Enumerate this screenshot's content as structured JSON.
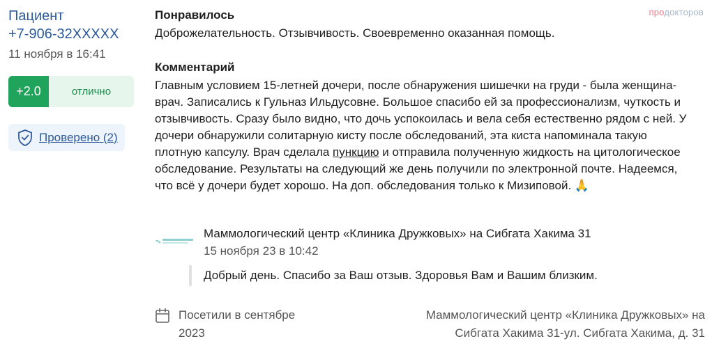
{
  "author": {
    "name_line1": "Пациент",
    "name_line2": "+7-906-32XXXXX",
    "date": "11 ноября в 16:41"
  },
  "rating": {
    "score": "+2.0",
    "verdict": "отлично"
  },
  "verified": {
    "label": "Проверено (2)"
  },
  "logo": {
    "part1": "про",
    "part2": "докторов"
  },
  "liked": {
    "title": "Понравилось",
    "text": "Доброжелательность. Отзывчивость. Своевременно оказанная помощь."
  },
  "comment": {
    "title": "Комментарий",
    "before_link": "Главным условием 15-летней дочери, после обнаружения шишечки на груди - была женщина-врач. Записались к Гульназ Ильдусовне. Большое спасибо ей за профессионализм, чуткость и отзывчивость. Сразу было видно, что дочь успокоилась и вела себя естественно рядом с ней. У дочери обнаружили солитарную кисту после обследований, эта киста напоминала такую плотную капсулу. Врач сделала ",
    "link": "пункцию",
    "after_link": " и отправила полученную жидкость на цитологическое обследование. Результаты на следующий же день получили по электронной почте. Надеемся, что всё у дочери будет хорошо. На доп. обследования только к Мизиповой. 🙏"
  },
  "reply": {
    "clinic_name": "Маммологический центр «Клиника Дружковых» на Сибгата Хакима 31",
    "date": "15 ноября 23 в 10:42",
    "text": "Добрый день. Спасибо за Ваш отзыв. Здоровья Вам и Вашим близким."
  },
  "footer": {
    "visit_line1": "Посетили в сентябре",
    "visit_line2": "2023",
    "address_line1": "Маммологический центр «Клиника Дружковых» на",
    "address_line2": "Сибгата Хакима 31-ул. Сибгата Хакима, д. 31"
  },
  "colors": {
    "link": "#2c5a9a",
    "rating_green": "#20a35a",
    "rating_bg": "#e6f6ec",
    "logo_pink": "#f4788a"
  }
}
